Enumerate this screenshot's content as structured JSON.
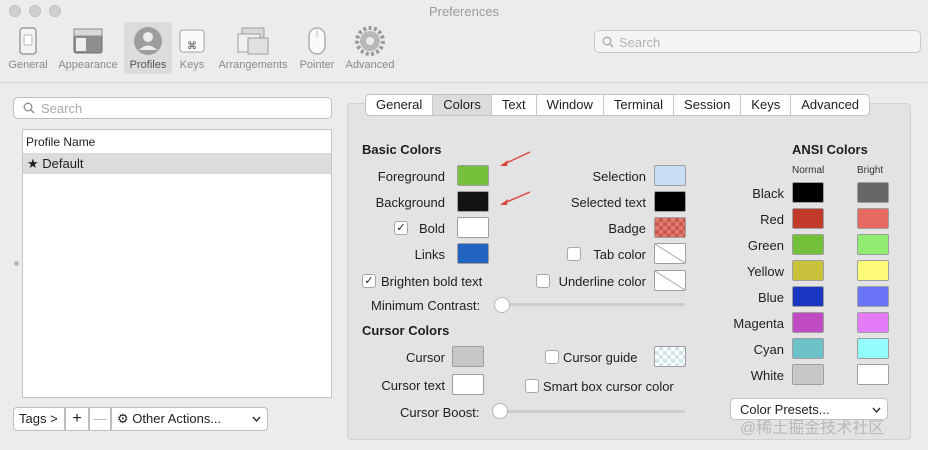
{
  "window": {
    "title": "Preferences"
  },
  "toolbar": {
    "items": [
      {
        "label": "General",
        "icon": "phone-icon"
      },
      {
        "label": "Appearance",
        "icon": "window-icon"
      },
      {
        "label": "Profiles",
        "icon": "person-icon",
        "selected": true
      },
      {
        "label": "Keys",
        "icon": "command-key-icon"
      },
      {
        "label": "Arrangements",
        "icon": "arrangements-icon"
      },
      {
        "label": "Pointer",
        "icon": "mouse-icon"
      },
      {
        "label": "Advanced",
        "icon": "gear-icon"
      }
    ],
    "search_placeholder": "Search"
  },
  "profiles": {
    "search_placeholder": "Search",
    "column_header": "Profile Name",
    "items": [
      {
        "name": "Default",
        "star": "★"
      }
    ],
    "buttons": {
      "tags": "Tags >",
      "add": "+",
      "remove": "—",
      "other_actions": "Other Actions..."
    }
  },
  "tabs": [
    "General",
    "Colors",
    "Text",
    "Window",
    "Terminal",
    "Session",
    "Keys",
    "Advanced"
  ],
  "active_tab": "Colors",
  "basic_colors": {
    "heading": "Basic Colors",
    "foreground": {
      "label": "Foreground",
      "color": "#76c13b"
    },
    "background": {
      "label": "Background",
      "color": "#131313"
    },
    "bold": {
      "label": "Bold",
      "checked": true,
      "check_glyph": "✓",
      "color": "#ffffff"
    },
    "links": {
      "label": "Links",
      "color": "#2264c2"
    },
    "brighten": {
      "label": "Brighten bold text",
      "checked": true,
      "check_glyph": "✓"
    },
    "selection": {
      "label": "Selection",
      "color": "#c9dff6"
    },
    "selected_text": {
      "label": "Selected text",
      "color": "#000000"
    },
    "badge": {
      "label": "Badge",
      "color": "#e07a70"
    },
    "tab_color": {
      "label": "Tab color",
      "checked": false
    },
    "underline_color": {
      "label": "Underline color",
      "checked": false
    },
    "min_contrast": {
      "label": "Minimum Contrast:",
      "value": 0
    }
  },
  "cursor_colors": {
    "heading": "Cursor Colors",
    "cursor": {
      "label": "Cursor",
      "color": "#c7c7c7"
    },
    "cursor_text": {
      "label": "Cursor text",
      "color": "#ffffff"
    },
    "cursor_guide": {
      "label": "Cursor guide",
      "checked": false
    },
    "smart_box": {
      "label": "Smart box cursor color",
      "checked": false
    },
    "cursor_boost": {
      "label": "Cursor Boost:",
      "value": 0
    }
  },
  "ansi": {
    "heading": "ANSI Colors",
    "normal_label": "Normal",
    "bright_label": "Bright",
    "rows": [
      {
        "name": "Black",
        "normal": "#000000",
        "bright": "#676767"
      },
      {
        "name": "Red",
        "normal": "#c13a2c",
        "bright": "#e66a62"
      },
      {
        "name": "Green",
        "normal": "#73c03a",
        "bright": "#93ec72"
      },
      {
        "name": "Yellow",
        "normal": "#c9c23c",
        "bright": "#fdfb77"
      },
      {
        "name": "Blue",
        "normal": "#1937c1",
        "bright": "#6873f5"
      },
      {
        "name": "Magenta",
        "normal": "#c04bc2",
        "bright": "#e27bf5"
      },
      {
        "name": "Cyan",
        "normal": "#6ec2c7",
        "bright": "#93fcfd"
      },
      {
        "name": "White",
        "normal": "#c7c7c7",
        "bright": "#ffffff"
      }
    ],
    "presets_label": "Color Presets..."
  },
  "watermark": "@稀土掘金技术社区",
  "accent_color": "#d9473a"
}
